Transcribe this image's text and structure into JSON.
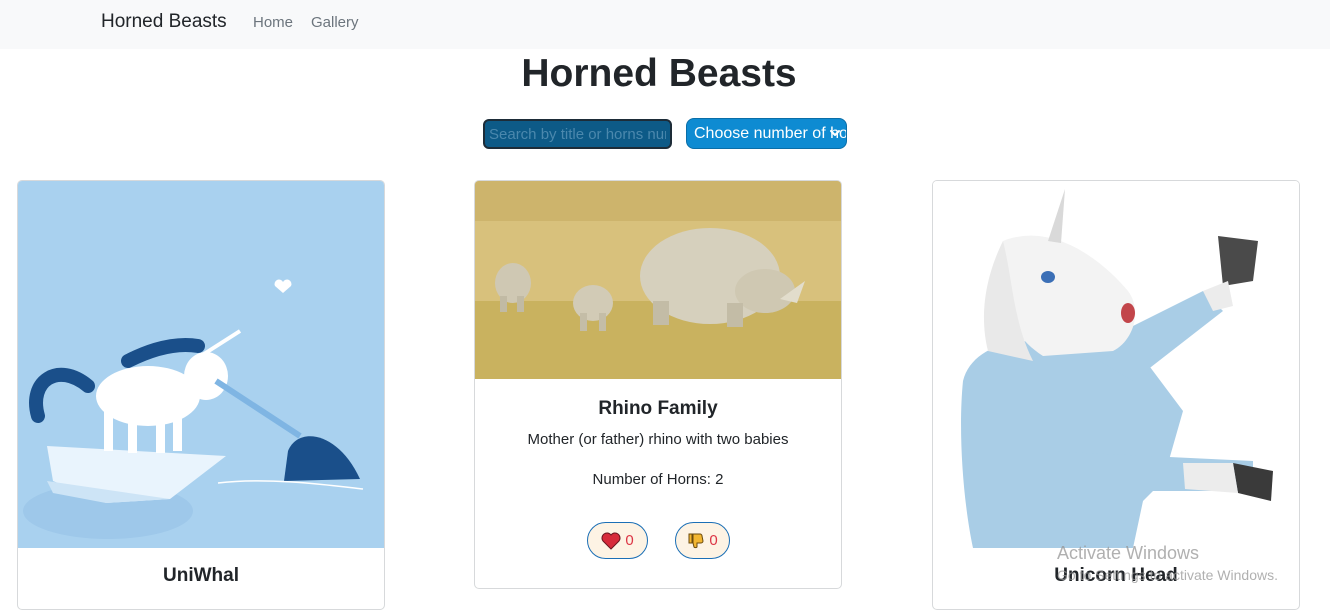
{
  "navbar": {
    "brand": "Horned Beasts",
    "links": [
      "Home",
      "Gallery"
    ]
  },
  "page": {
    "title": "Horned Beasts"
  },
  "filters": {
    "search_placeholder": "Search by title or horns number",
    "select_value": "Choose number of horns"
  },
  "cards": [
    {
      "title": "UniWhal",
      "image": "unicorn and narwhal illustration"
    },
    {
      "title": "Rhino Family",
      "image": "rhino family photo",
      "description": "Mother (or father) rhino with two babies",
      "horns": "Number of Horns: 2",
      "likes": "0",
      "dislikes": "0"
    },
    {
      "title": "Unicorn Head",
      "image": "person in unicorn mask photo"
    }
  ],
  "watermark": {
    "line1": "Activate Windows",
    "line2": "Go to Settings to activate Windows."
  },
  "colors": {
    "navbar_bg": "#f8f9fa",
    "search_bg": "#0d5a87",
    "select_bg": "#0e8bd2",
    "vote_border": "#1b6fb6",
    "vote_bg": "#fdf3e4"
  }
}
